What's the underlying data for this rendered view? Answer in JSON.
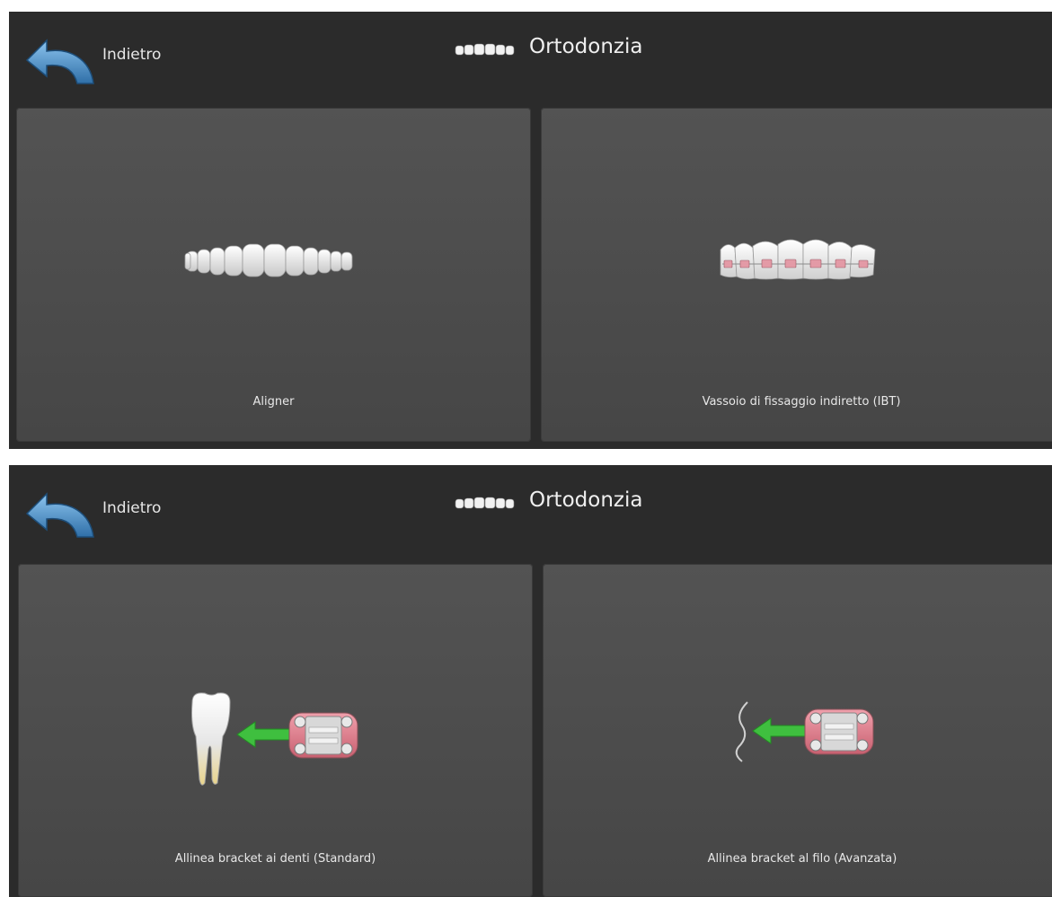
{
  "panels": [
    {
      "header": {
        "back_label": "Indietro",
        "title": "Ortodonzia"
      },
      "cards": [
        {
          "label": "Aligner",
          "icon": "aligner-teeth-icon"
        },
        {
          "label": "Vassoio di fissaggio indiretto (IBT)",
          "icon": "braces-teeth-icon"
        }
      ]
    },
    {
      "header": {
        "back_label": "Indietro",
        "title": "Ortodonzia"
      },
      "cards": [
        {
          "label": "Allinea bracket ai denti (Standard)",
          "icon": "tooth-bracket-align-icon"
        },
        {
          "label": "Allinea bracket al filo (Avanzata)",
          "icon": "wire-bracket-align-icon"
        }
      ]
    }
  ],
  "colors": {
    "background": "#2b2b2b",
    "card": "#4d4d4d",
    "back_arrow": "#4a90c8",
    "green_arrow": "#3fbf3f",
    "bracket_pink": "#e07f8c"
  }
}
